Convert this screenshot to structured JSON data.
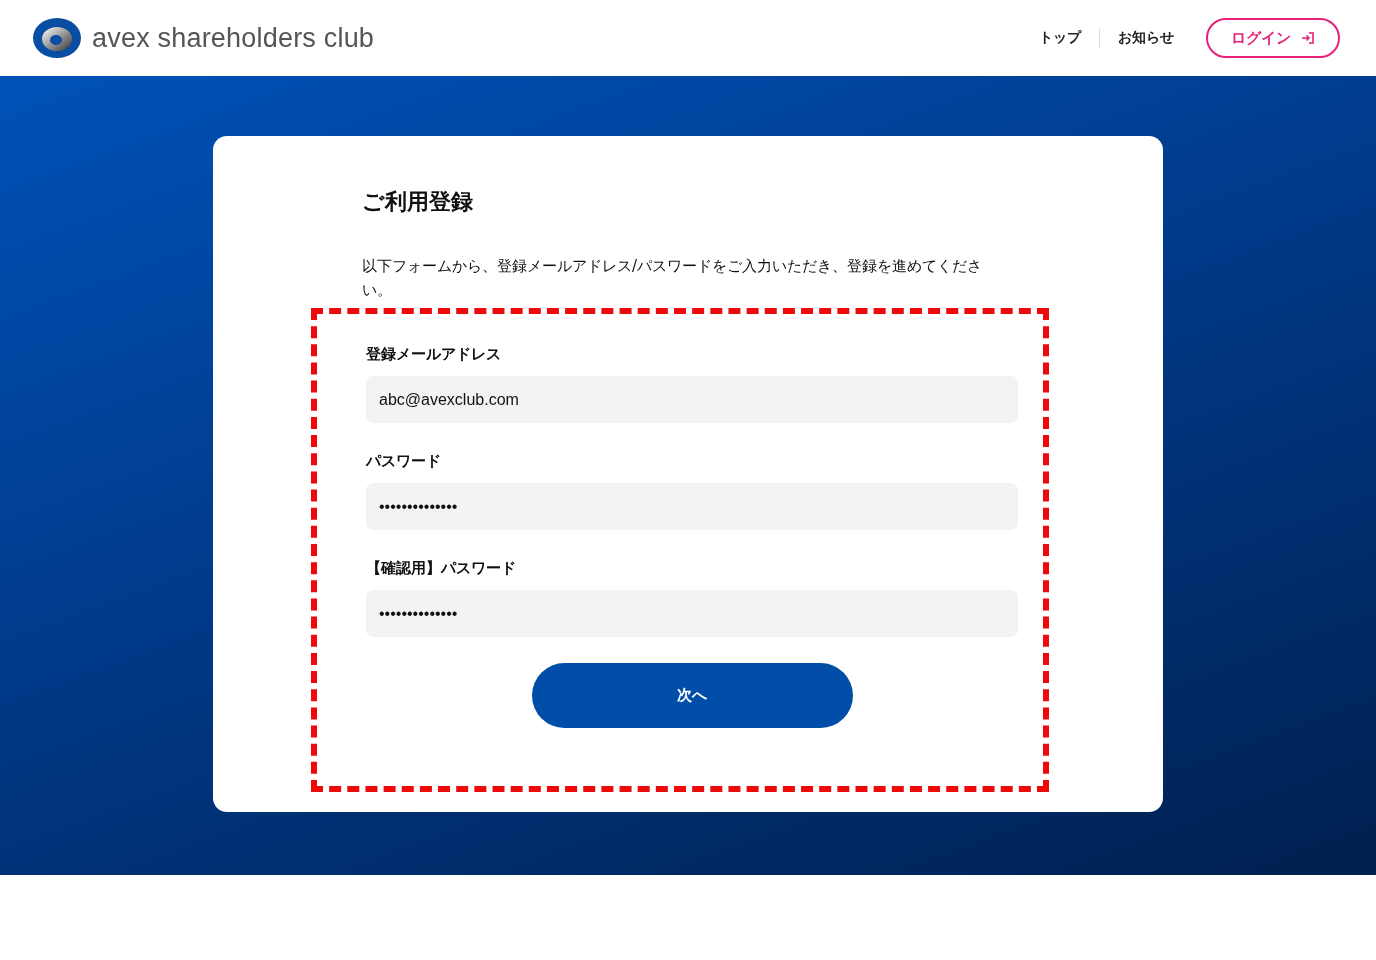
{
  "header": {
    "logo_text": "avex shareholders club",
    "nav": [
      "トップ",
      "お知らせ"
    ],
    "login_button": "ログイン"
  },
  "card": {
    "title": "ご利用登録",
    "description": "以下フォームから、登録メールアドレス/パスワードをご入力いただき、登録を進めてください。",
    "highlighted": true,
    "fields": [
      {
        "label": "登録メールアドレス",
        "value": "abc@avexclub.com"
      },
      {
        "label": "パスワード",
        "value": "••••••••••••••"
      },
      {
        "label": "【確認用】パスワード",
        "value": "••••••••••••••"
      }
    ],
    "submit_button": "次へ"
  }
}
